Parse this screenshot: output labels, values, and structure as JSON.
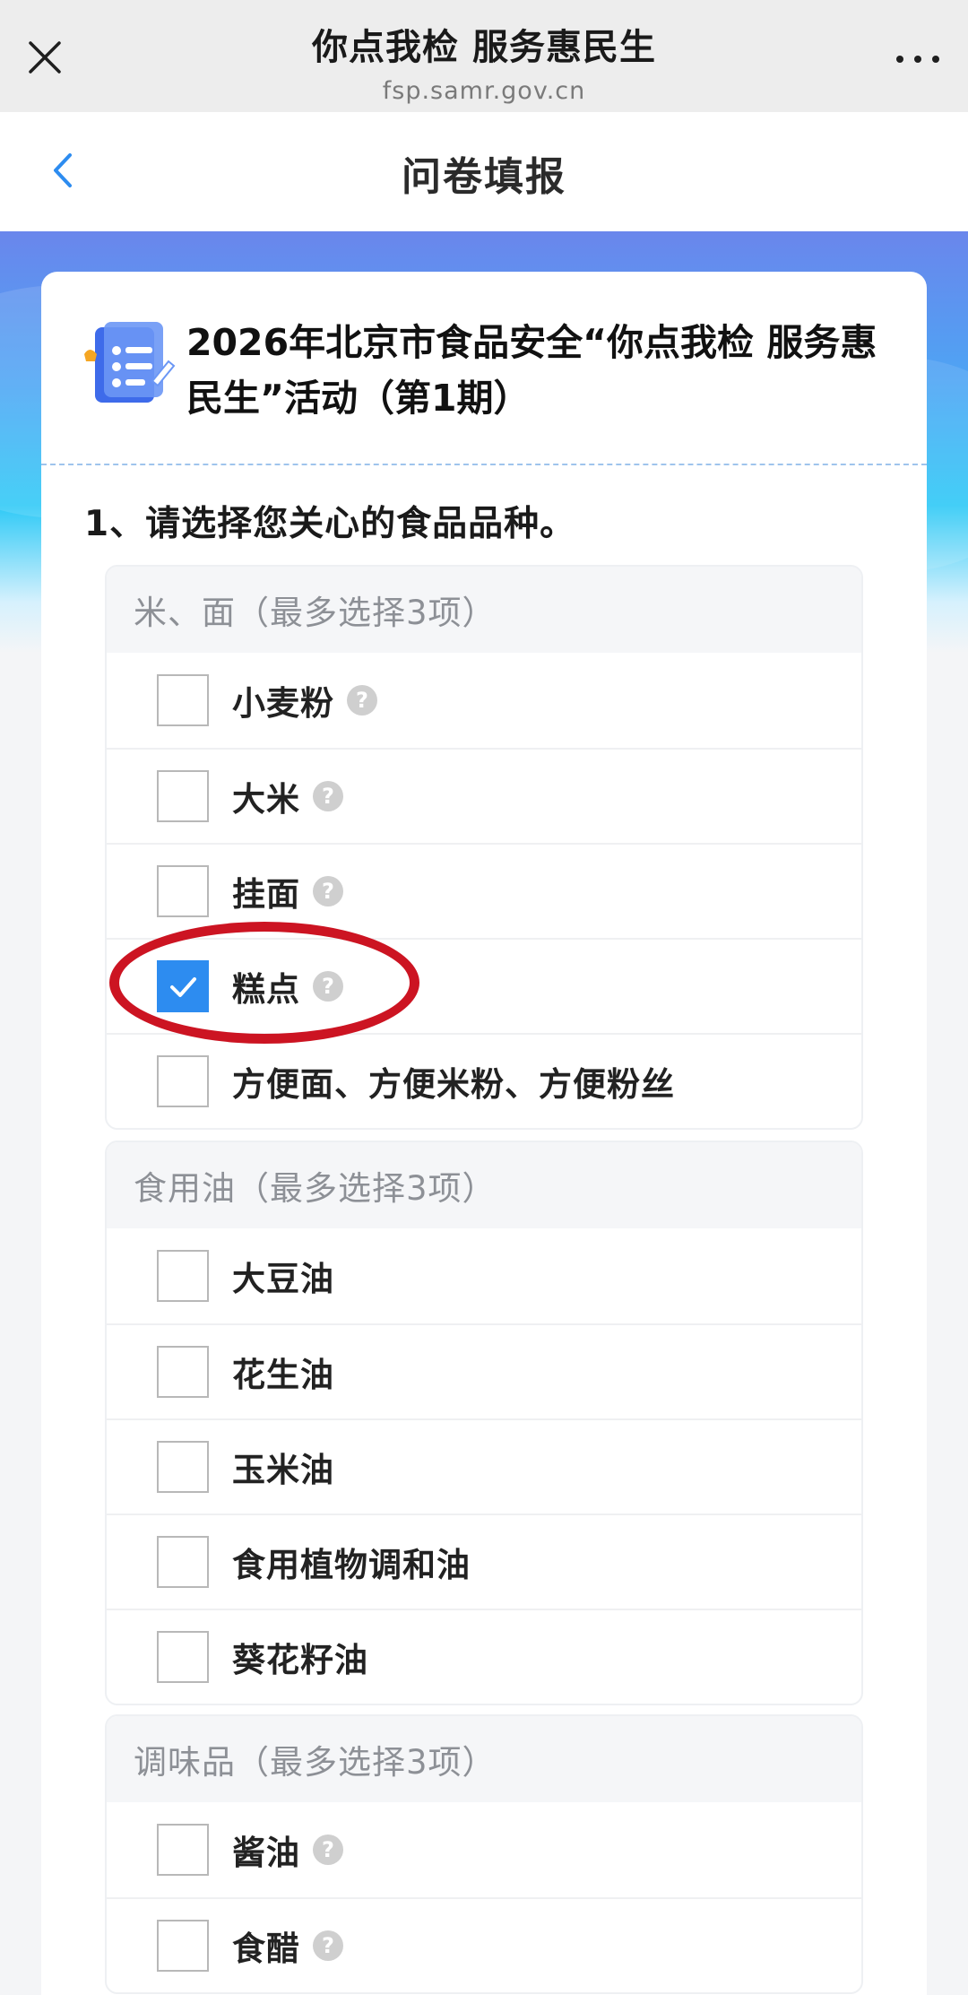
{
  "topbar": {
    "title": "你点我检 服务惠民生",
    "url": "fsp.samr.gov.cn"
  },
  "nav": {
    "title": "问卷填报"
  },
  "survey": {
    "title": "2026年北京市食品安全“你点我检 服务惠民生”活动（第1期）",
    "question": "1、请选择您关心的食品品种。"
  },
  "groups": [
    {
      "header": "米、面（最多选择3项）",
      "options": [
        {
          "label": "小麦粉",
          "checked": false,
          "help": true
        },
        {
          "label": "大米",
          "checked": false,
          "help": true
        },
        {
          "label": "挂面",
          "checked": false,
          "help": true
        },
        {
          "label": "糕点",
          "checked": true,
          "help": true
        },
        {
          "label": "方便面、方便米粉、方便粉丝",
          "checked": false,
          "help": false
        }
      ]
    },
    {
      "header": "食用油（最多选择3项）",
      "options": [
        {
          "label": "大豆油",
          "checked": false,
          "help": false
        },
        {
          "label": "花生油",
          "checked": false,
          "help": false
        },
        {
          "label": "玉米油",
          "checked": false,
          "help": false
        },
        {
          "label": "食用植物调和油",
          "checked": false,
          "help": false
        },
        {
          "label": "葵花籽油",
          "checked": false,
          "help": false
        }
      ]
    },
    {
      "header": "调味品（最多选择3项）",
      "options": [
        {
          "label": "酱油",
          "checked": false,
          "help": true
        },
        {
          "label": "食醋",
          "checked": false,
          "help": true
        }
      ]
    }
  ],
  "help_glyph": "?",
  "icons": {
    "close": "close-icon",
    "more": "more-icon",
    "back": "back-arrow-icon",
    "survey": "survey-document-icon",
    "help": "question-mark-icon",
    "check": "checkmark-icon"
  },
  "colors": {
    "accent": "#2d8cf0",
    "annotation": "#cc1422",
    "hero_top": "#6a86ec",
    "hero_mid": "#2ec9f6"
  }
}
